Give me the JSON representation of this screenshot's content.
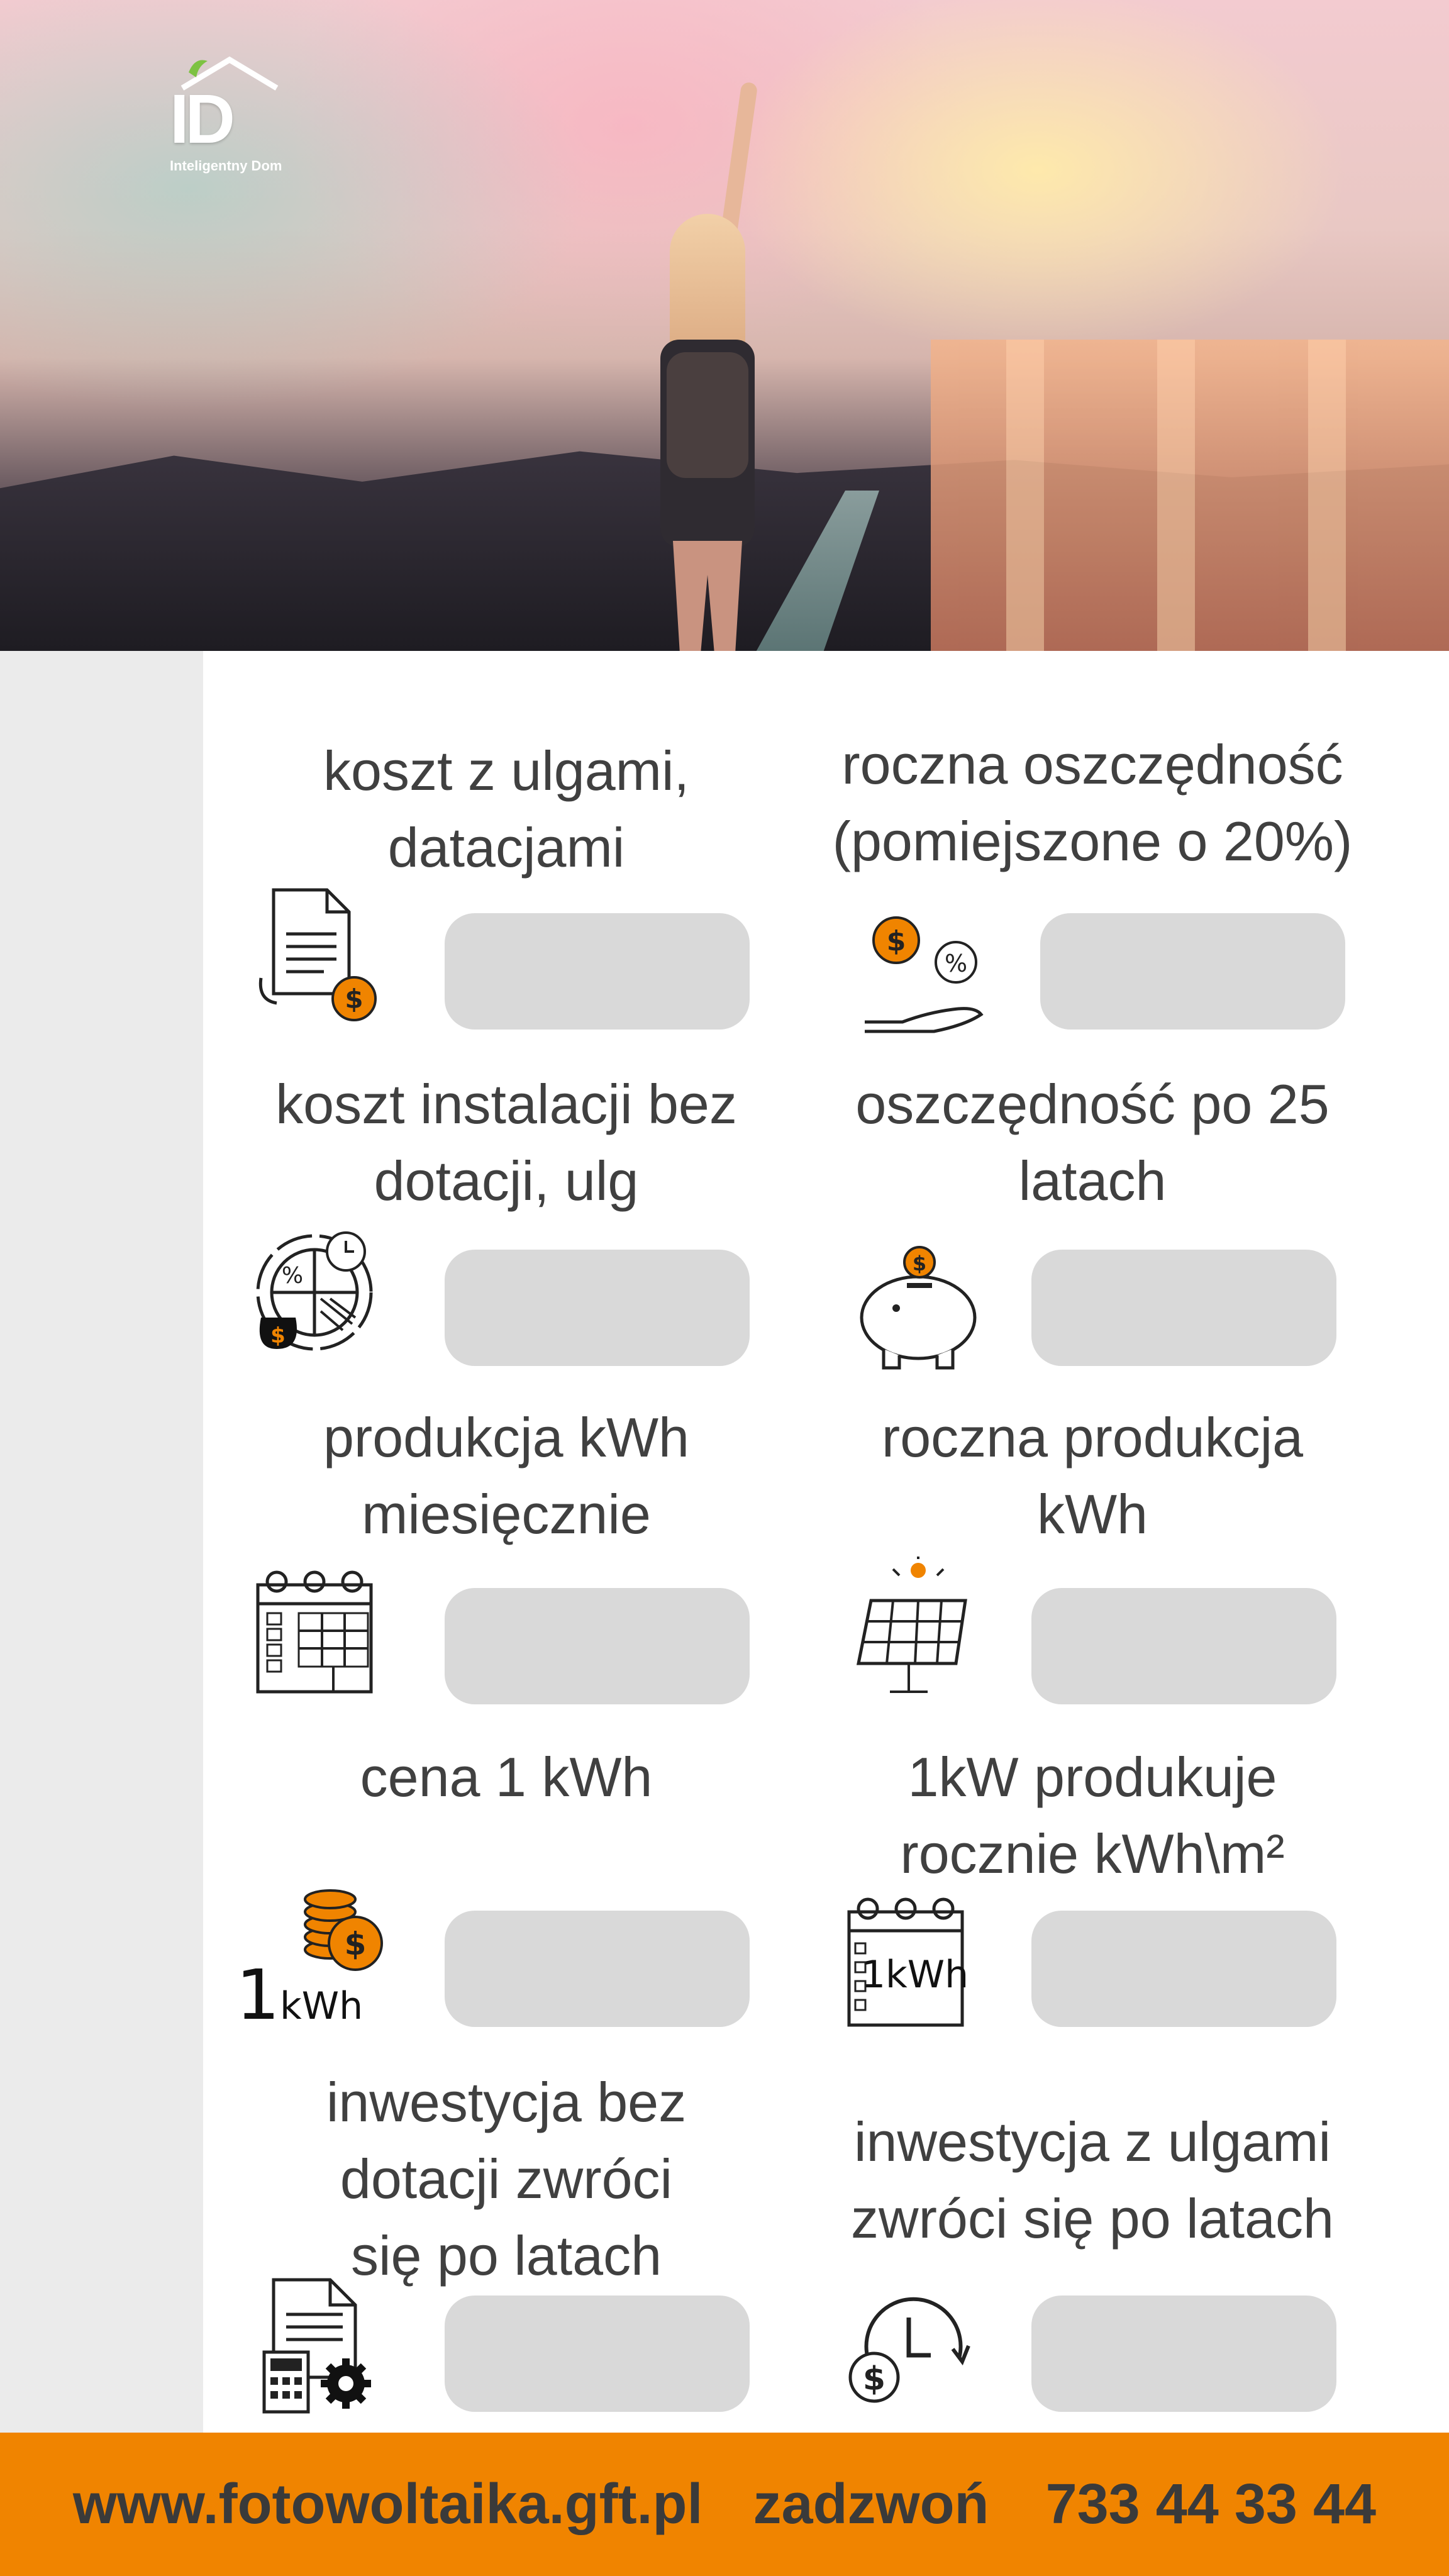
{
  "brand": {
    "logo_mark": "ID",
    "logo_name": "Inteligentny Dom"
  },
  "cards": [
    {
      "label_lines": [
        "koszt z ulgami,",
        "datacjami"
      ],
      "icon": "document-dollar-icon",
      "value": ""
    },
    {
      "label_lines": [
        "roczna oszczędność",
        "(pomiejszone o 20%)"
      ],
      "icon": "hand-coins-percent-icon",
      "value": ""
    },
    {
      "label_lines": [
        "koszt instalacji bez",
        "dotacji, ulg"
      ],
      "icon": "pie-chart-money-icon",
      "value": ""
    },
    {
      "label_lines": [
        "oszczędność po 25",
        "latach"
      ],
      "icon": "piggy-bank-icon",
      "value": ""
    },
    {
      "label_lines": [
        "produkcja kWh",
        "miesięcznie"
      ],
      "icon": "calendar-solar-panel-icon",
      "value": ""
    },
    {
      "label_lines": [
        "roczna produkcja",
        "kWh"
      ],
      "icon": "solar-panel-sun-icon",
      "value": ""
    },
    {
      "label_lines": [
        "cena 1 kWh"
      ],
      "icon": "coins-kwh-icon",
      "value": ""
    },
    {
      "label_lines": [
        "1kW produkuje",
        "rocznie kWh\\m²"
      ],
      "icon": "calendar-kwh-icon",
      "value": ""
    },
    {
      "label_lines": [
        "inwestycja bez",
        "dotacji zwróci",
        "się po latach"
      ],
      "icon": "calculator-document-gear-icon",
      "value": ""
    },
    {
      "label_lines": [
        "inwestycja z ulgami",
        "zwróci się po latach"
      ],
      "icon": "clock-dollar-return-icon",
      "value": ""
    }
  ],
  "icon_texts": {
    "one": "1",
    "kwh": "kWh",
    "one_kwh": "1kWh",
    "dollar": "$",
    "percent": "%"
  },
  "footer": {
    "website": "www.fotowoltaika.gft.pl",
    "call_label": "zadzwoń",
    "phone": "733 44 33 44"
  },
  "colors": {
    "accent": "#f08400",
    "text": "#404040",
    "field": "#d9d9d9",
    "sidebar": "#ebebeb"
  }
}
